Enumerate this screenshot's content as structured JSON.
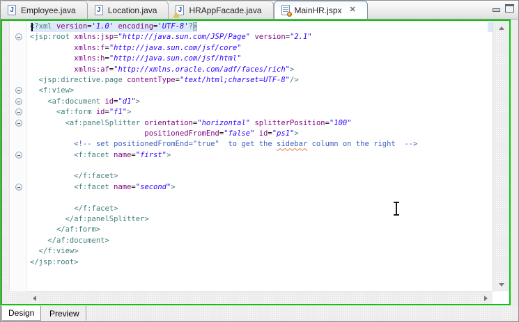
{
  "editor_tabs": {
    "tabs": [
      {
        "label": "Employee.java",
        "icon": "java-file-icon",
        "active": false,
        "warning": false,
        "closable": false
      },
      {
        "label": "Location.java",
        "icon": "java-file-icon",
        "active": false,
        "warning": false,
        "closable": false
      },
      {
        "label": "HRAppFacade.java",
        "icon": "java-file-icon",
        "active": false,
        "warning": true,
        "closable": false
      },
      {
        "label": "MainHR.jspx",
        "icon": "jspx-file-icon",
        "active": true,
        "warning": false,
        "closable": true
      }
    ],
    "close_glyph": "✕"
  },
  "bottom_tabs": {
    "tabs": [
      {
        "label": "Design",
        "active": true
      },
      {
        "label": "Preview",
        "active": false
      }
    ]
  },
  "icons": {
    "minimize": "minimize-view-icon",
    "maximize": "maximize-view-icon",
    "warning_overlay": "warning-overlay-icon",
    "fold_collapse": "collapse-icon"
  },
  "code": {
    "language": "jspx-xml",
    "current_line": 1,
    "fold_lines": [
      2,
      7,
      8,
      9,
      10,
      13,
      16
    ],
    "colors": {
      "tag": "#3f7f7f",
      "attr": "#7f007f",
      "value": "#2a00ff",
      "comment": "#3f5fbf",
      "plain": "#000000",
      "line_highlight": "#dce9f8",
      "match_bg": "#ccd6e2",
      "focus_border": "#0bc40b",
      "misspell_underline": "#e07b39"
    },
    "lines": [
      [
        [
          "tag",
          "<?xml "
        ],
        [
          "attr",
          "version"
        ],
        [
          "eq",
          "="
        ],
        [
          "val",
          "'1.0'"
        ],
        [
          "plain",
          " "
        ],
        [
          "attr",
          "encoding"
        ],
        [
          "eq",
          "="
        ],
        [
          "val",
          "'UTF-8'"
        ],
        [
          "tag",
          "?"
        ],
        [
          "match",
          ">"
        ]
      ],
      [
        [
          "tag",
          "<jsp:root "
        ],
        [
          "attr",
          "xmlns:jsp"
        ],
        [
          "eq",
          "="
        ],
        [
          "val",
          "\"http://java.sun.com/JSP/Page\""
        ],
        [
          "plain",
          " "
        ],
        [
          "attr",
          "version"
        ],
        [
          "eq",
          "="
        ],
        [
          "val",
          "\"2.1\""
        ]
      ],
      [
        [
          "plain",
          "          "
        ],
        [
          "attr",
          "xmlns:f"
        ],
        [
          "eq",
          "="
        ],
        [
          "val",
          "\"http://java.sun.com/jsf/core\""
        ]
      ],
      [
        [
          "plain",
          "          "
        ],
        [
          "attr",
          "xmlns:h"
        ],
        [
          "eq",
          "="
        ],
        [
          "val",
          "\"http://java.sun.com/jsf/html\""
        ]
      ],
      [
        [
          "plain",
          "          "
        ],
        [
          "attr",
          "xmlns:af"
        ],
        [
          "eq",
          "="
        ],
        [
          "val",
          "\"http://xmlns.oracle.com/adf/faces/rich\""
        ],
        [
          "tag",
          ">"
        ]
      ],
      [
        [
          "plain",
          "  "
        ],
        [
          "tag",
          "<jsp:directive.page "
        ],
        [
          "attr",
          "contentType"
        ],
        [
          "eq",
          "="
        ],
        [
          "val",
          "\"text/html;charset=UTF-8\""
        ],
        [
          "tag",
          "/>"
        ]
      ],
      [
        [
          "plain",
          "  "
        ],
        [
          "tag",
          "<f:view>"
        ]
      ],
      [
        [
          "plain",
          "    "
        ],
        [
          "tag",
          "<af:document "
        ],
        [
          "attr",
          "id"
        ],
        [
          "eq",
          "="
        ],
        [
          "val",
          "\"d1\""
        ],
        [
          "tag",
          ">"
        ]
      ],
      [
        [
          "plain",
          "      "
        ],
        [
          "tag",
          "<af:form "
        ],
        [
          "attr",
          "id"
        ],
        [
          "eq",
          "="
        ],
        [
          "val",
          "\"f1\""
        ],
        [
          "tag",
          ">"
        ]
      ],
      [
        [
          "plain",
          "        "
        ],
        [
          "tag",
          "<af:panelSplitter "
        ],
        [
          "attr",
          "orientation"
        ],
        [
          "eq",
          "="
        ],
        [
          "val",
          "\"horizontal\""
        ],
        [
          "plain",
          " "
        ],
        [
          "attr",
          "splitterPosition"
        ],
        [
          "eq",
          "="
        ],
        [
          "val",
          "\"100\""
        ]
      ],
      [
        [
          "plain",
          "                          "
        ],
        [
          "attr",
          "positionedFromEnd"
        ],
        [
          "eq",
          "="
        ],
        [
          "val",
          "\"false\""
        ],
        [
          "plain",
          " "
        ],
        [
          "attr",
          "id"
        ],
        [
          "eq",
          "="
        ],
        [
          "val",
          "\"ps1\""
        ],
        [
          "tag",
          ">"
        ]
      ],
      [
        [
          "plain",
          "          "
        ],
        [
          "comment",
          "<!-- set positionedFromEnd=\"true\"  to get the "
        ],
        [
          "misspell",
          "sidebar"
        ],
        [
          "comment",
          " column on the right  -->"
        ]
      ],
      [
        [
          "plain",
          "          "
        ],
        [
          "tag",
          "<f:facet "
        ],
        [
          "attr",
          "name"
        ],
        [
          "eq",
          "="
        ],
        [
          "val",
          "\"first\""
        ],
        [
          "tag",
          ">"
        ]
      ],
      [],
      [
        [
          "plain",
          "          "
        ],
        [
          "tag",
          "</f:facet>"
        ]
      ],
      [
        [
          "plain",
          "          "
        ],
        [
          "tag",
          "<f:facet "
        ],
        [
          "attr",
          "name"
        ],
        [
          "eq",
          "="
        ],
        [
          "val",
          "\"second\""
        ],
        [
          "tag",
          ">"
        ]
      ],
      [],
      [
        [
          "plain",
          "          "
        ],
        [
          "tag",
          "</f:facet>"
        ]
      ],
      [
        [
          "plain",
          "        "
        ],
        [
          "tag",
          "</af:panelSplitter>"
        ]
      ],
      [
        [
          "plain",
          "      "
        ],
        [
          "tag",
          "</af:form>"
        ]
      ],
      [
        [
          "plain",
          "    "
        ],
        [
          "tag",
          "</af:document>"
        ]
      ],
      [
        [
          "plain",
          "  "
        ],
        [
          "tag",
          "</f:view>"
        ]
      ],
      [
        [
          "tag",
          "</jsp:root>"
        ]
      ]
    ]
  }
}
